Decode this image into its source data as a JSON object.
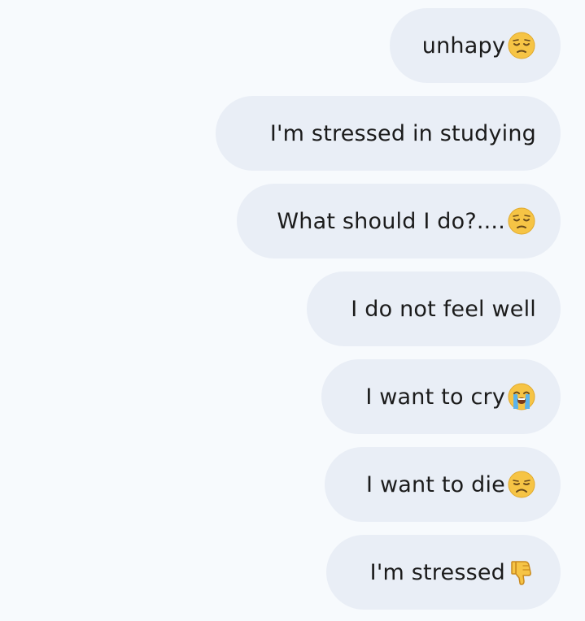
{
  "messages": [
    {
      "text": "unhapy",
      "emoji": "pensive-face-icon"
    },
    {
      "text": "I'm stressed in studying",
      "emoji": ""
    },
    {
      "text": "What should I do?....",
      "emoji": "pensive-face-icon"
    },
    {
      "text": "I do not feel well",
      "emoji": ""
    },
    {
      "text": "I want to cry",
      "emoji": "loudly-crying-face-icon"
    },
    {
      "text": "I want to die",
      "emoji": "disappointed-face-icon"
    },
    {
      "text": "I'm stressed",
      "emoji": "thumbs-down-icon"
    }
  ],
  "colors": {
    "background": "#f7fafd",
    "bubble": "#e9eef6",
    "text": "#1b1b1b",
    "emoji_yellow": "#f6c445"
  }
}
